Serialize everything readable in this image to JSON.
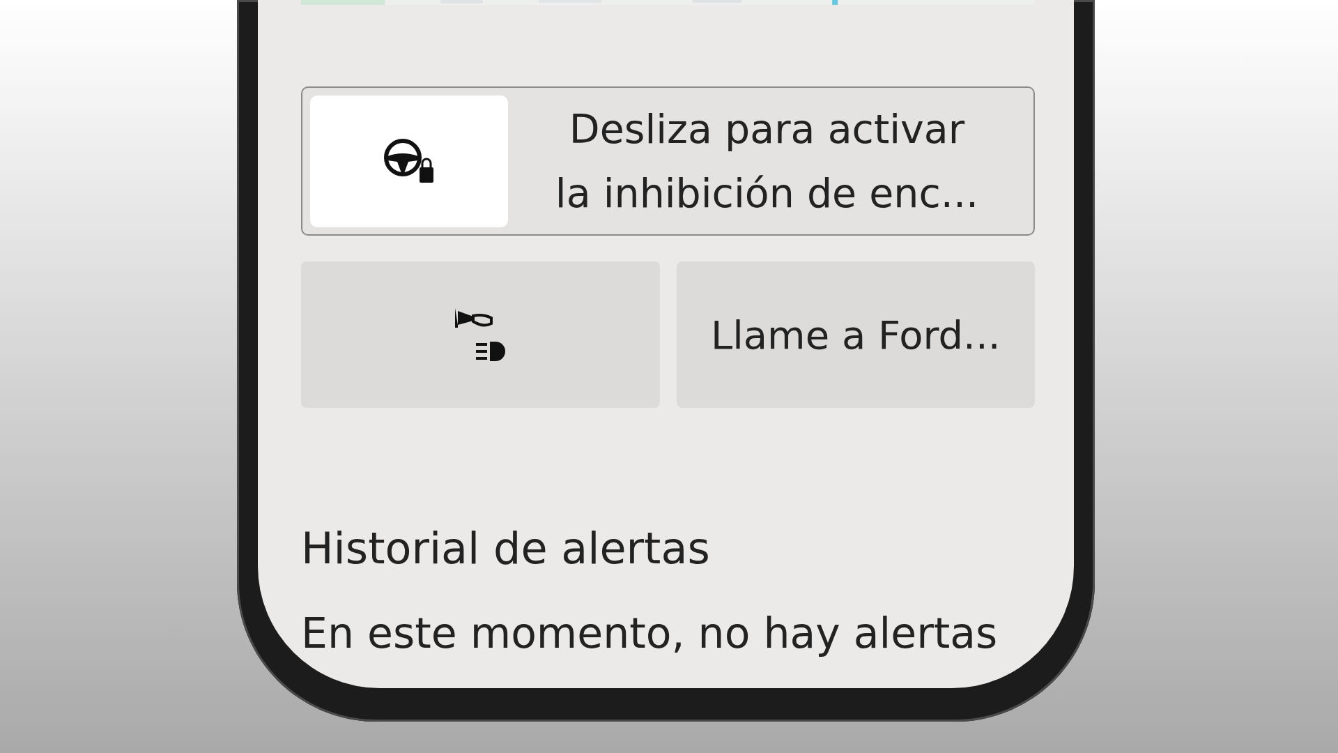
{
  "slider": {
    "level": 0,
    "label": "Desliza para activar\nla inhibición de enc..."
  },
  "buttons": [
    {
      "kind": "horn-lights"
    },
    {
      "kind": "text",
      "label": "Llame a Ford..."
    }
  ],
  "alerts": {
    "title": "Historial de alertas",
    "message": "En este momento, no hay alertas"
  }
}
